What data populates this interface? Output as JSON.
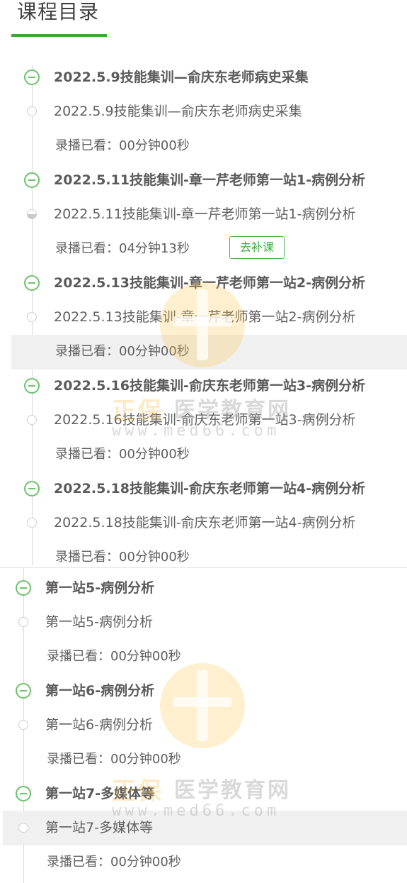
{
  "page": {
    "title": "课程目录"
  },
  "watermark": {
    "brand": "正保",
    "site": "医学教育网",
    "url": "www.med66.com"
  },
  "sections": [
    {
      "chapters": [
        {
          "title": "2022.5.9技能集训—俞庆东老师病史采集",
          "lesson": {
            "title": "2022.5.9技能集训—俞庆东老师病史采集",
            "watched": "录播已看：00分钟00秒",
            "progress": 0
          }
        },
        {
          "title": "2022.5.11技能集训-章一芹老师第一站1-病例分析",
          "lesson": {
            "title": "2022.5.11技能集训-章一芹老师第一站1-病例分析",
            "watched": "录播已看：04分钟13秒",
            "button": "去补课",
            "progress": 0.5
          }
        },
        {
          "title": "2022.5.13技能集训-章一芹老师第一站2-病例分析",
          "lesson": {
            "title": "2022.5.13技能集训-章一芹老师第一站2-病例分析",
            "watched": "录播已看：00分钟00秒",
            "progress": 0
          }
        },
        {
          "title": "2022.5.16技能集训-俞庆东老师第一站3-病例分析",
          "lesson": {
            "title": "2022.5.16技能集训-俞庆东老师第一站3-病例分析",
            "watched": "录播已看：00分钟00秒",
            "progress": 0
          }
        },
        {
          "title": "2022.5.18技能集训-俞庆东老师第一站4-病例分析",
          "lesson": {
            "title": "2022.5.18技能集训-俞庆东老师第一站4-病例分析",
            "watched": "录播已看：00分钟00秒",
            "progress": 0
          }
        }
      ]
    },
    {
      "chapters": [
        {
          "title": "第一站5-病例分析",
          "lesson": {
            "title": "第一站5-病例分析",
            "watched": "录播已看：00分钟00秒",
            "progress": 0
          }
        },
        {
          "title": "第一站6-病例分析",
          "lesson": {
            "title": "第一站6-病例分析",
            "watched": "录播已看：00分钟00秒",
            "progress": 0
          }
        },
        {
          "title": "第一站7-多媒体等",
          "lesson": {
            "title": "第一站7-多媒体等",
            "watched": "录播已看：00分钟00秒",
            "progress": 0
          }
        }
      ]
    }
  ],
  "colors": {
    "accent": "#41a63a",
    "icon": "#6cc36b",
    "text": "#555555",
    "highlight": "#f0f0f0"
  },
  "icons": {
    "chapter": "collapse-minus-circle-icon",
    "lesson": "progress-circle-icon"
  }
}
